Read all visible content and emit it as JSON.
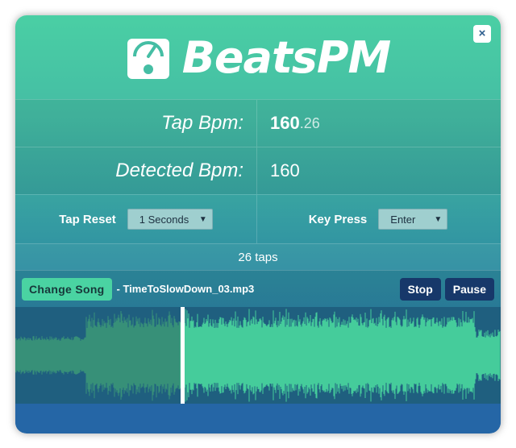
{
  "app": {
    "title": "BeatsPM",
    "close_label": "×"
  },
  "bpm": {
    "tap_label": "Tap Bpm:",
    "tap_int": "160",
    "tap_dec": ".26",
    "detected_label": "Detected Bpm:",
    "detected_value": "160"
  },
  "settings": {
    "tap_reset_label": "Tap Reset",
    "tap_reset_value": "1 Seconds",
    "key_press_label": "Key Press",
    "key_press_value": "Enter"
  },
  "taps": "26 taps",
  "player": {
    "change_song_label": "Change Song",
    "song_name": "- TimeToSlowDown_03.mp3",
    "stop_label": "Stop",
    "pause_label": "Pause",
    "progress": 0.34
  },
  "colors": {
    "wave": "#45cc9b",
    "wave_played": "#379078",
    "wave_bg": "#1f5f7f",
    "cursor": "#ffffff"
  },
  "icons": {
    "logo": "speedometer-icon",
    "close": "close-icon"
  }
}
